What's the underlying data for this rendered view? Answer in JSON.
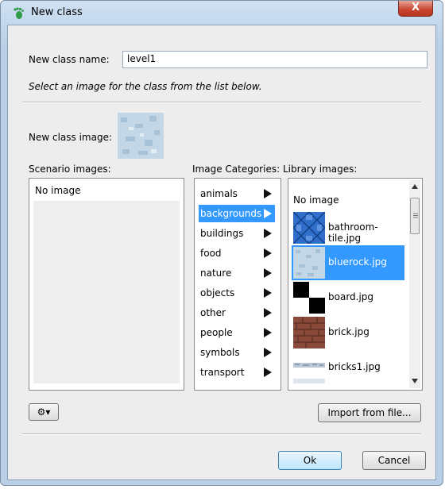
{
  "window": {
    "title": "New class",
    "close_glyph": "X"
  },
  "form": {
    "name_label": "New class name:",
    "name_value": "level1",
    "hint": "Select an image for the class from the list below.",
    "image_label": "New class image:"
  },
  "scenario": {
    "label": "Scenario images:",
    "items": [
      "No image"
    ]
  },
  "categories": {
    "label": "Image Categories:",
    "items": [
      "animals",
      "backgrounds",
      "buildings",
      "food",
      "nature",
      "objects",
      "other",
      "people",
      "symbols",
      "transport"
    ],
    "selected": "backgrounds"
  },
  "library": {
    "label": "Library images:",
    "no_image": "No image",
    "items": [
      "bathroom-tile.jpg",
      "bluerock.jpg",
      "board.jpg",
      "brick.jpg",
      "bricks1.jpg"
    ],
    "selected": "bluerock.jpg"
  },
  "buttons": {
    "import": "Import from file...",
    "ok": "Ok",
    "cancel": "Cancel",
    "gear_menu": "⚙▾"
  },
  "colors": {
    "selection": "#3399ff",
    "accent": "#3c7fb1"
  }
}
